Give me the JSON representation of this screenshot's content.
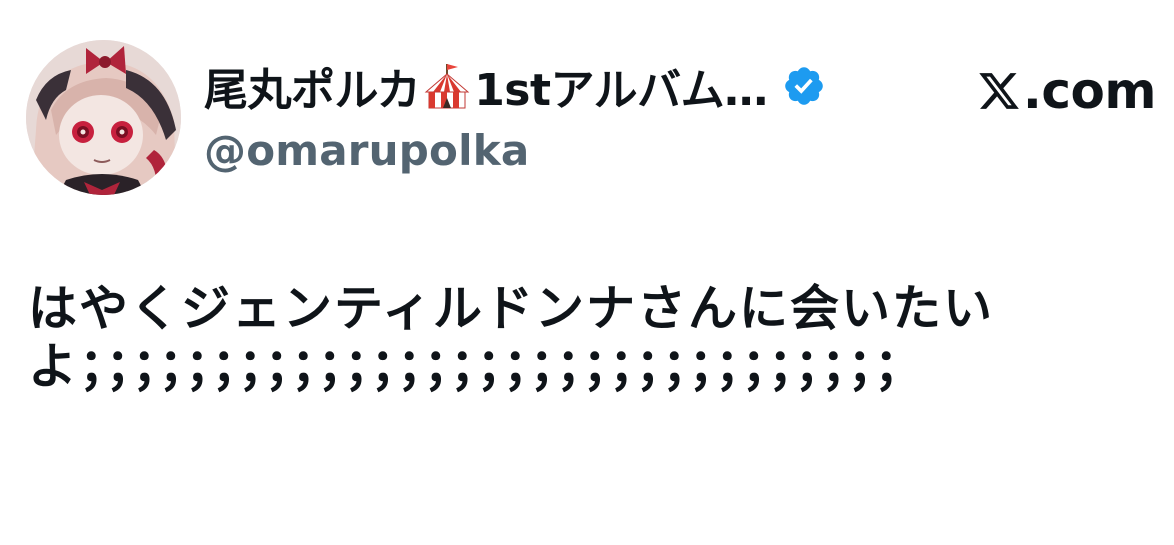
{
  "tweet": {
    "author": {
      "display_name": "尾丸ポルカ",
      "name_emoji": "circus-tent-icon",
      "name_suffix": "1stアルバム…",
      "verified": true,
      "verified_icon": "verified-badge-icon",
      "handle": "@omarupolka",
      "avatar": "avatar-illustration"
    },
    "site": {
      "logo_label": ".com",
      "logo_icon": "x-logo-icon"
    },
    "text": "はやくジェンティルドンナさんに会いたいよ；；；；；；；；；；；；；；；；；；；；；；；；；；；；；；；"
  },
  "colors": {
    "text_primary": "#0f1419",
    "text_secondary": "#536471",
    "verified_blue": "#1d9bf0",
    "background": "#ffffff"
  }
}
